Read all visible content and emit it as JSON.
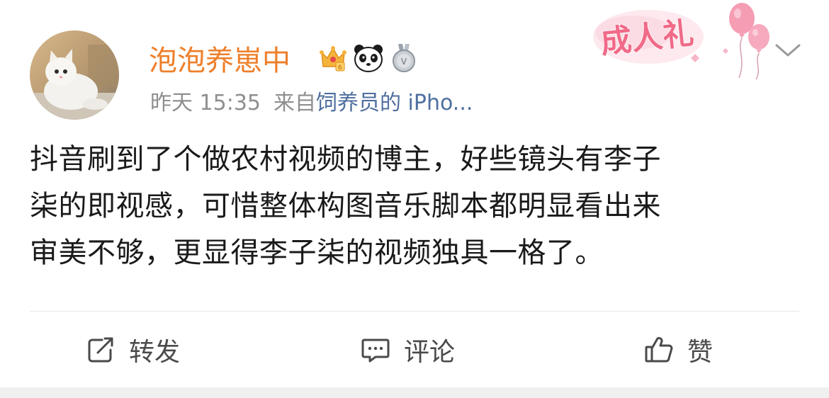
{
  "post": {
    "username": "泡泡养崽中",
    "timestamp": "昨天 15:35",
    "source_prefix": "来自",
    "source_name": "饲养员的 iPho...",
    "content": "抖音刷到了个做农村视频的博主，好些镜头有李子\n柒的即视感，可惜整体构图音乐脚本都明显看出来\n审美不够，更显得李子柒的视频独具一格了。",
    "decoration_label": "成人礼",
    "badges": [
      "crown-vip-icon",
      "panda-icon",
      "medal-icon"
    ]
  },
  "actions": {
    "repost_label": "转发",
    "comment_label": "评论",
    "like_label": "赞"
  },
  "colors": {
    "username": "#ee7f2a",
    "source_link": "#4f6f9f",
    "meta": "#8f8f8f",
    "content": "#1a1a1a",
    "action": "#4a4a4a",
    "decoration_text": "#f06a88"
  }
}
